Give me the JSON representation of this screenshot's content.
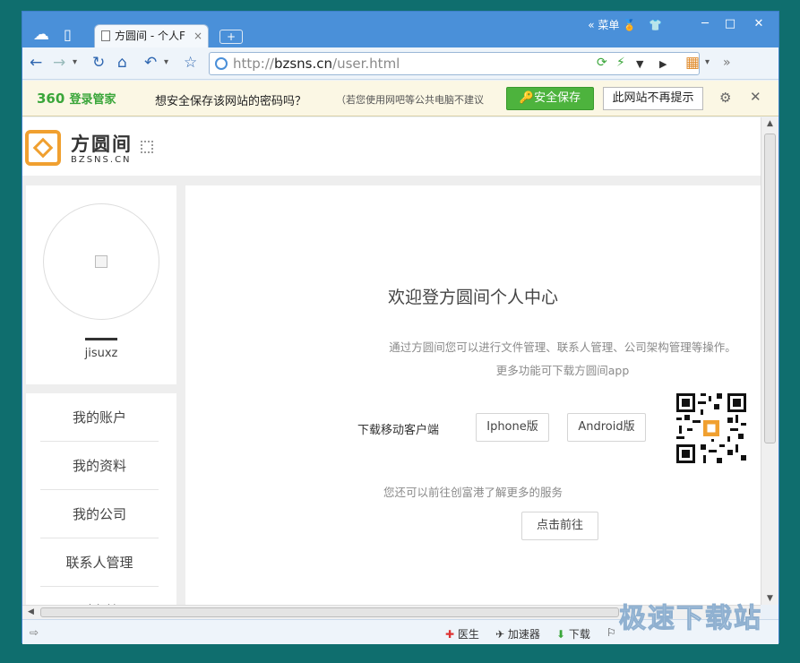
{
  "browser": {
    "tab_title": "方圆间 - 个人F",
    "tab_close": "×",
    "new_tab": "+",
    "menu_label": "菜单",
    "address_scheme": "http://",
    "address_host": "bzsns.cn",
    "address_path": "/user.html",
    "window_buttons": [
      "─",
      "□",
      "✕"
    ]
  },
  "password_bar": {
    "brand_360": "360",
    "brand_name": "登录管家",
    "question": "想安全保存该网站的密码吗？",
    "note": "（若您使用网吧等公共电脑不建议",
    "save_button": "🔑安全保存",
    "never_button": "此网站不再提示"
  },
  "site": {
    "logo_title": "方圆间",
    "logo_sub": "BZSNS.CN"
  },
  "profile": {
    "username": "jisuxz"
  },
  "sidebar_menu": [
    "我的账户",
    "我的资料",
    "我的公司",
    "联系人管理",
    "财务管"
  ],
  "main": {
    "welcome": "欢迎登方圆间个人中心",
    "desc1": "通过方圆间您可以进行文件管理、联系人管理、公司架构管理等操作。",
    "desc2": "更多功能可下载方圆间app",
    "download_label": "下载移动客户端",
    "iphone_button": "Iphone版",
    "android_button": "Android版",
    "more_services": "您还可以前往创富港了解更多的服务",
    "go_button": "点击前往"
  },
  "statusbar": {
    "doctor": "医生",
    "accelerator": "加速器",
    "download": "下载",
    "watermark": "极速下载站"
  },
  "colors": {
    "title_blue": "#4a90d9",
    "save_green": "#4db33d",
    "logo_orange": "#f0a030"
  }
}
